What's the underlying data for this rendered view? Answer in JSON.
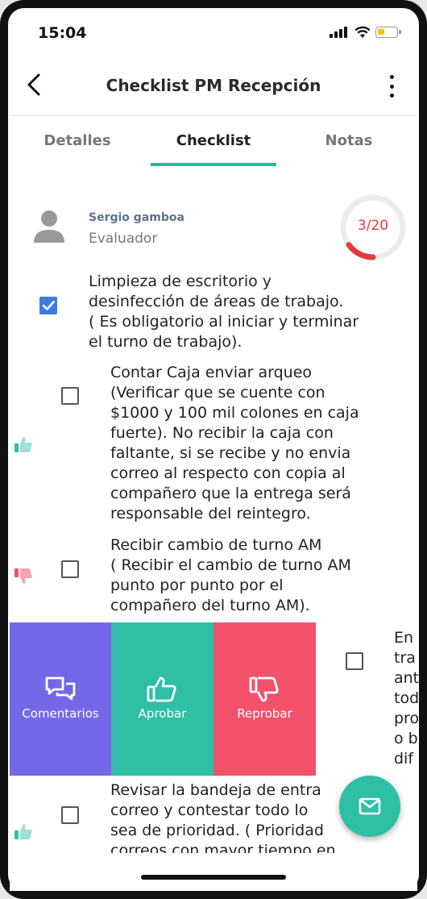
{
  "status_bar": {
    "time": "15:04"
  },
  "header": {
    "title": "Checklist PM Recepción"
  },
  "tabs": [
    {
      "label": "Detalles"
    },
    {
      "label": "Checklist"
    },
    {
      "label": "Notas"
    }
  ],
  "evaluator": {
    "name": "Sergio gamboa",
    "role": "Evaluador"
  },
  "progress": {
    "label": "3/20",
    "done": 3,
    "total": 20,
    "color": "#e63a3a"
  },
  "items": [
    {
      "text": "Limpieza de escritorio y\ndesinfección de áreas de trabajo.\n( Es obligatorio al iniciar y terminar\nel turno de trabajo).",
      "checked": true,
      "status": "none"
    },
    {
      "text": "Contar Caja enviar arqueo\n(Verificar que se cuente con\n$1000 y 100 mil colones en caja\nfuerte). No recibir la caja con\nfaltante, si se recibe y no envia\ncorreo al respecto con copia al\ncompañero que la entrega será\nresponsable del reintegro.",
      "checked": false,
      "status": "approved"
    },
    {
      "text": "Recibir cambio de turno AM\n( Recibir el cambio de turno AM\npunto por punto por el\ncompañero del turno AM).",
      "checked": false,
      "status": "rejected"
    },
    {
      "text": "En\ntra\nant\ntod\npro\no b\ndif",
      "checked": false,
      "status": "none"
    },
    {
      "text": "Revisar la bandeja de entra\ncorreo y contestar todo lo\nsea de prioridad. ( Prioridad\ncorreos con mayor tiempo en",
      "checked": false,
      "status": "approved"
    }
  ],
  "swipe_actions": [
    {
      "label": "Comentarios",
      "icon": "chat-bubbles-icon",
      "color": "#7468e8"
    },
    {
      "label": "Aprobar",
      "icon": "thumbs-up-icon",
      "color": "#2ebfa5"
    },
    {
      "label": "Reprobar",
      "icon": "thumbs-down-icon",
      "color": "#f1526a"
    }
  ],
  "fab": {
    "icon": "mail-icon",
    "color": "#2ebfa5"
  },
  "colors": {
    "accent": "#2eb5a0",
    "checkbox_checked": "#3a7de0",
    "approve": "#2ebfa5",
    "reject": "#f1526a"
  }
}
